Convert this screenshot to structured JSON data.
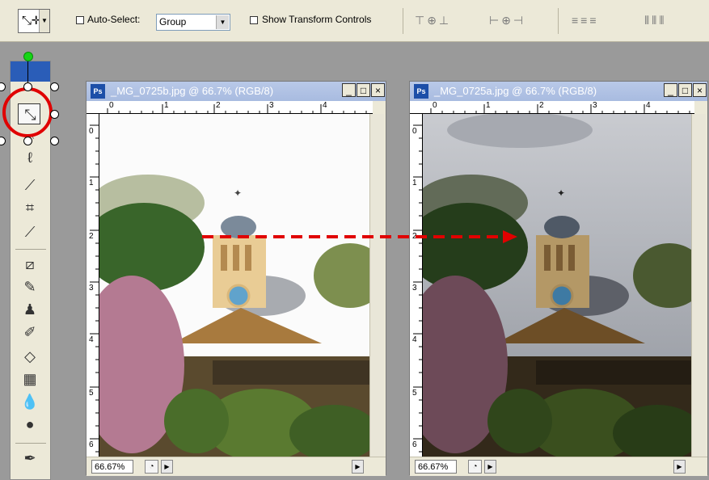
{
  "options_bar": {
    "auto_select_label": "Auto-Select:",
    "auto_select_value": "Group",
    "show_transform_label": "Show Transform Controls"
  },
  "windows": [
    {
      "title": "_MG_0725b.jpg @ 66.7% (RGB/8)",
      "zoom": "66.67%",
      "ruler_h": [
        "0",
        "1",
        "2",
        "3",
        "4"
      ],
      "ruler_v": [
        "0",
        "1",
        "2",
        "3",
        "4",
        "5",
        "6"
      ]
    },
    {
      "title": "_MG_0725a.jpg @ 66.7% (RGB/8)",
      "zoom": "66.67%",
      "ruler_h": [
        "0",
        "1",
        "2",
        "3",
        "4"
      ],
      "ruler_v": [
        "0",
        "1",
        "2",
        "3",
        "4",
        "5",
        "6"
      ]
    }
  ],
  "icons": {
    "move_tool": "move-tool-icon",
    "window_minimize": "minimize-icon",
    "window_maximize": "maximize-icon",
    "window_close": "close-icon"
  },
  "colors": {
    "annotation_red": "#e00000",
    "rotate_handle": "#15d615",
    "titlebar_inactive": "#a8bbe0"
  }
}
